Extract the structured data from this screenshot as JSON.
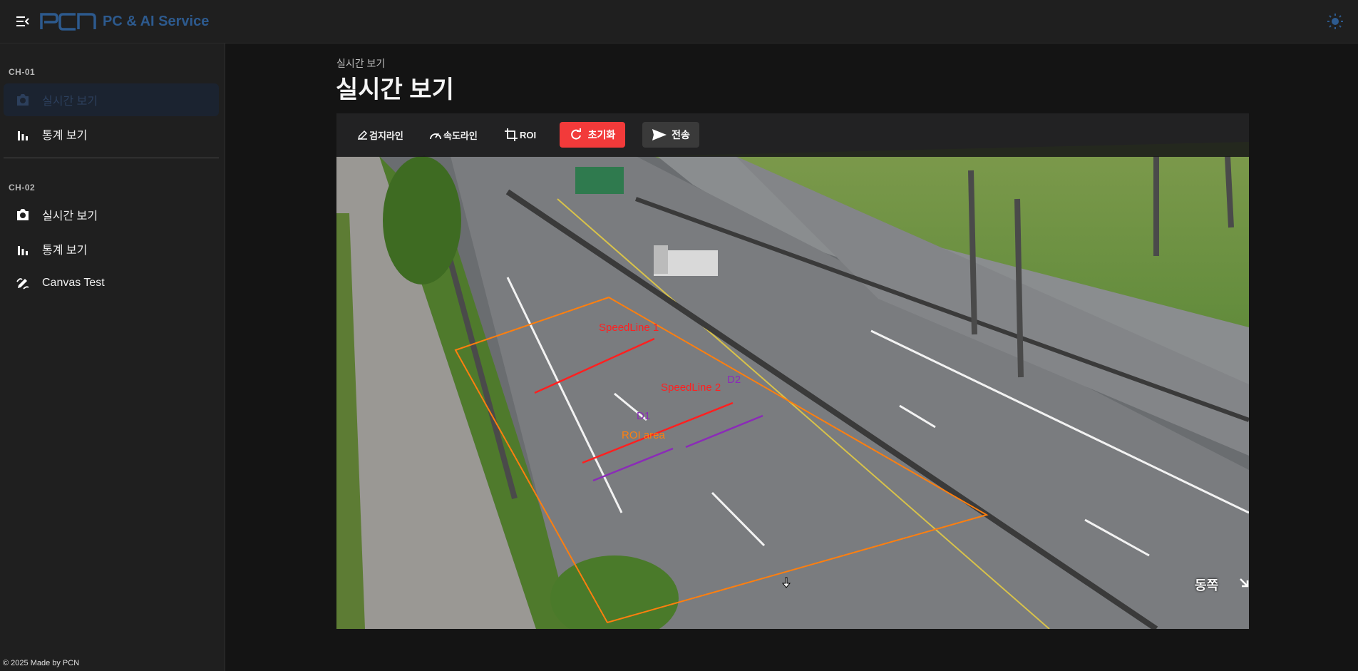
{
  "header": {
    "brand_logo": "PCN",
    "brand_name": "PC & AI Service"
  },
  "sidebar": {
    "sections": [
      {
        "title": "CH-01",
        "items": [
          {
            "label": "실시간 보기",
            "icon": "camera-icon",
            "active": true
          },
          {
            "label": "통계 보기",
            "icon": "bar-chart-icon"
          }
        ]
      },
      {
        "title": "CH-02",
        "items": [
          {
            "label": "실시간 보기",
            "icon": "camera-icon"
          },
          {
            "label": "통계 보기",
            "icon": "bar-chart-icon"
          },
          {
            "label": "Canvas Test",
            "icon": "draw-icon"
          }
        ]
      }
    ]
  },
  "footer": {
    "text": "© 2025 Made by PCN"
  },
  "page": {
    "breadcrumb": "실시간 보기",
    "title": "실시간 보기"
  },
  "toolbar": {
    "detect_line": "검지라인",
    "speed_line": "속도라인",
    "roi": "ROI",
    "reset": "초기화",
    "send": "전송"
  },
  "overlay": {
    "speedline1": "SpeedLine 1",
    "speedline2": "SpeedLine 2",
    "d1": "D1",
    "d2": "D2",
    "roi_area": "ROI area",
    "direction": "동쪽"
  },
  "colors": {
    "accent": "#2d5a8e",
    "reset": "#f23a3a",
    "roi": "#ff7f0e",
    "speedline": "#ff2020",
    "distance": "#8b2bb8"
  }
}
